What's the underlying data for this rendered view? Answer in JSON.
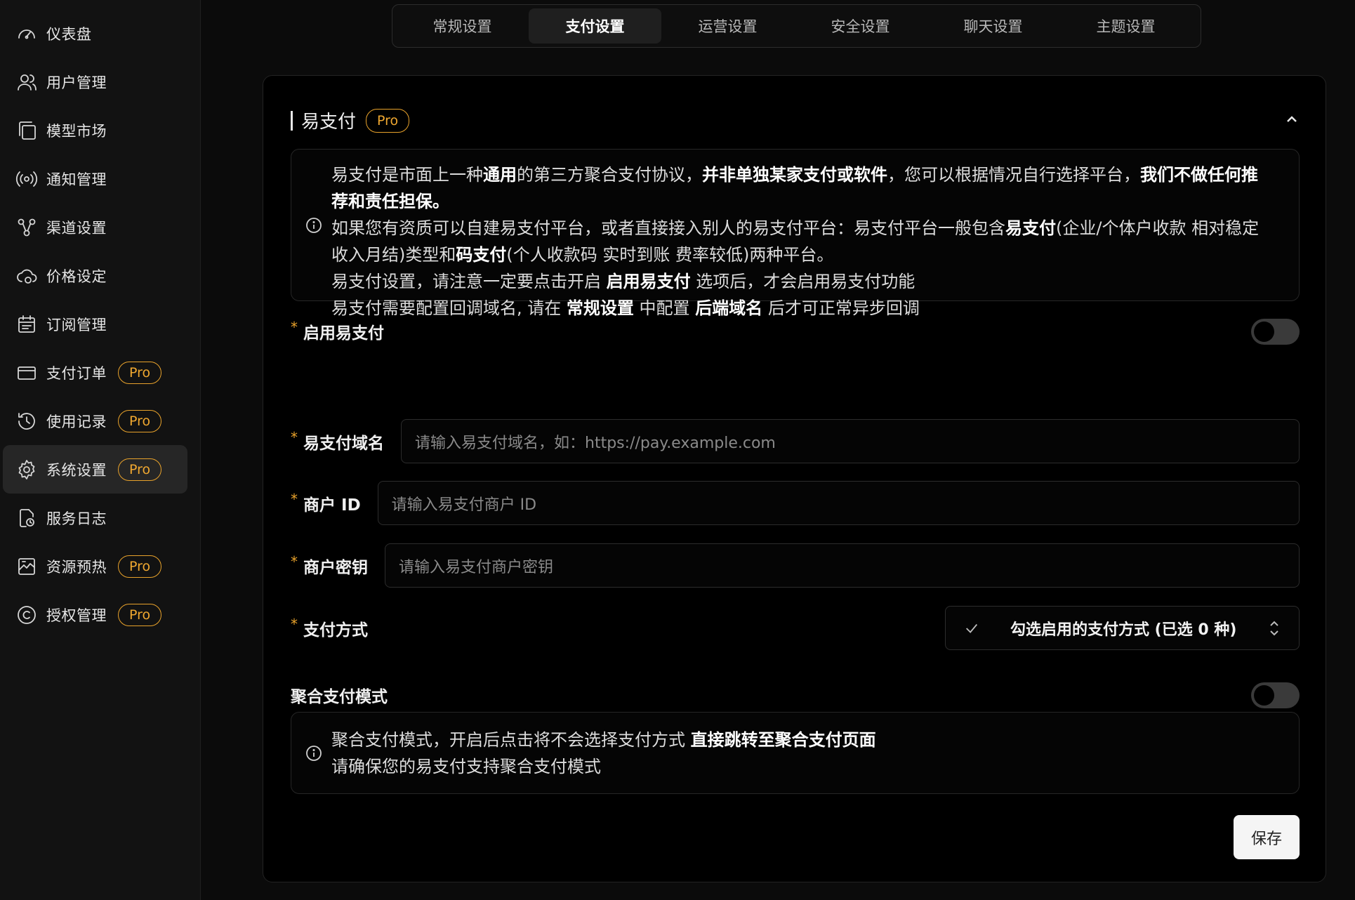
{
  "sidebar": {
    "items": [
      {
        "label": "仪表盘",
        "icon": "gauge-icon",
        "pro": false,
        "active": false
      },
      {
        "label": "用户管理",
        "icon": "users-icon",
        "pro": false,
        "active": false
      },
      {
        "label": "模型市场",
        "icon": "copy-icon",
        "pro": false,
        "active": false
      },
      {
        "label": "通知管理",
        "icon": "broadcast-icon",
        "pro": false,
        "active": false
      },
      {
        "label": "渠道设置",
        "icon": "nodes-icon",
        "pro": false,
        "active": false
      },
      {
        "label": "价格设定",
        "icon": "cloud-coin-icon",
        "pro": false,
        "active": false
      },
      {
        "label": "订阅管理",
        "icon": "calendar-icon",
        "pro": false,
        "active": false
      },
      {
        "label": "支付订单",
        "icon": "card-icon",
        "pro": true,
        "active": false
      },
      {
        "label": "使用记录",
        "icon": "history-icon",
        "pro": true,
        "active": false
      },
      {
        "label": "系统设置",
        "icon": "gear-icon",
        "pro": true,
        "active": true
      },
      {
        "label": "服务日志",
        "icon": "file-clock-icon",
        "pro": false,
        "active": false
      },
      {
        "label": "资源预热",
        "icon": "warmup-icon",
        "pro": true,
        "active": false
      },
      {
        "label": "授权管理",
        "icon": "copyright-icon",
        "pro": true,
        "active": false
      }
    ],
    "pro_label": "Pro"
  },
  "tabs": [
    "常规设置",
    "支付设置",
    "运营设置",
    "安全设置",
    "聊天设置",
    "主题设置"
  ],
  "active_tab": 1,
  "card": {
    "title": "易支付",
    "pro_label": "Pro",
    "info1": {
      "l1_a": "易支付是市面上一种",
      "l1_b": "通用",
      "l1_c": "的第三方聚合支付协议，",
      "l1_d": "并非单独某家支付或软件",
      "l1_e": "，您可以根据情况自行选择平台，",
      "l1_f": "我们不做任何推荐和责任担保。",
      "l2_a": "如果您有资质可以自建易支付平台，或者直接接入别人的易支付平台：易支付平台一般包含",
      "l2_b": "易支付",
      "l2_c": "(企业/个体户收款 相对稳定 收入月结)类型和",
      "l2_d": "码支付",
      "l2_e": "(个人收款码 实时到账 费率较低)两种平台。",
      "l3_a": "易支付设置，请注意一定要点击开启",
      "l3_b": "启用易支付",
      "l3_c": "选项后，才会启用易支付功能",
      "l4_a": "易支付需要配置回调域名, 请在",
      "l4_b": "常规设置",
      "l4_c": "中配置",
      "l4_d": "后端域名",
      "l4_e": "后才可正常异步回调"
    },
    "fields": {
      "enable_label": "启用易支付",
      "enable_on": false,
      "domain_label": "易支付域名",
      "domain_placeholder": "请输入易支付域名，如：https://pay.example.com",
      "merchant_id_label": "商户 ID",
      "merchant_id_placeholder": "请输入易支付商户 ID",
      "merchant_key_label": "商户密钥",
      "merchant_key_placeholder": "请输入易支付商户密钥",
      "pay_method_label": "支付方式",
      "pay_method_value": "勾选启用的支付方式 (已选 0 种)",
      "aggregate_label": "聚合支付模式",
      "aggregate_on": false
    },
    "info2": {
      "l1_a": "聚合支付模式，开启后点击将不会选择支付方式",
      "l1_b": "直接跳转至聚合支付页面",
      "l2": "请确保您的易支付支持聚合支付模式"
    },
    "save_label": "保存",
    "required_mark": "*"
  }
}
